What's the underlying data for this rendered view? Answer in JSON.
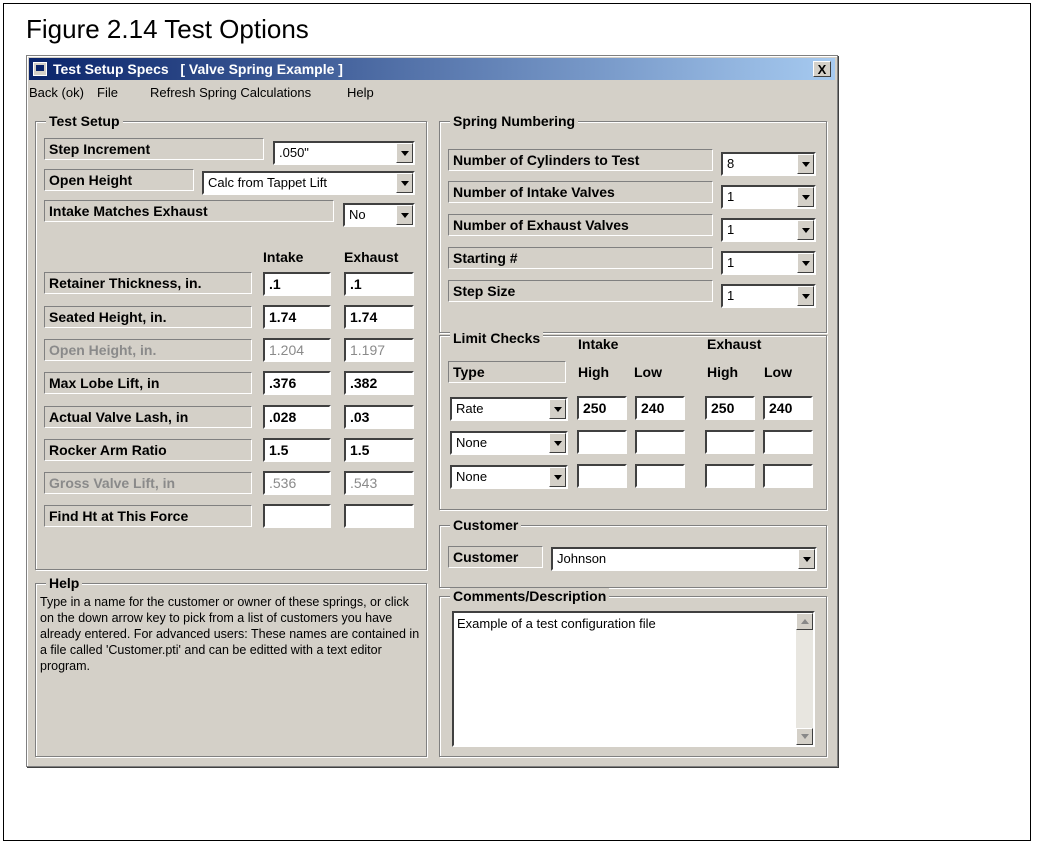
{
  "figure_caption": "Figure 2.14 Test Options",
  "window": {
    "title": "Test Setup Specs   [ Valve Spring Example ]",
    "close_label": "X"
  },
  "menu": [
    "Back (ok)",
    "File",
    "Refresh Spring Calculations",
    "Help"
  ],
  "test_setup": {
    "title": "Test Setup",
    "step_increment": {
      "label": "Step Increment",
      "value": ".050\""
    },
    "open_height": {
      "label": "Open Height",
      "value": "Calc from Tappet Lift"
    },
    "intake_matches_exhaust": {
      "label": "Intake Matches Exhaust",
      "value": "No"
    },
    "col_intake": "Intake",
    "col_exhaust": "Exhaust",
    "rows": [
      {
        "label": "Retainer Thickness, in.",
        "intake": ".1",
        "exhaust": ".1"
      },
      {
        "label": "Seated Height, in.",
        "intake": "1.74",
        "exhaust": "1.74"
      },
      {
        "label": "Open Height, in.",
        "intake": "1.204",
        "exhaust": "1.197"
      },
      {
        "label": "Max Lobe Lift, in",
        "intake": ".376",
        "exhaust": ".382"
      },
      {
        "label": "Actual Valve Lash, in",
        "intake": ".028",
        "exhaust": ".03"
      },
      {
        "label": "Rocker Arm Ratio",
        "intake": "1.5",
        "exhaust": "1.5"
      },
      {
        "label": "Gross Valve Lift, in",
        "intake": ".536",
        "exhaust": ".543"
      },
      {
        "label": "Find Ht at This Force",
        "intake": "",
        "exhaust": ""
      }
    ]
  },
  "help": {
    "title": "Help",
    "text": "Type in a name for the customer or owner of these springs, or click on the down arrow key to pick from a list of customers you have already entered.  For advanced users:  These names are contained in a file called 'Customer.pti' and can be editted with a text editor program."
  },
  "spring_numbering": {
    "title": "Spring Numbering",
    "rows": [
      {
        "label": "Number of Cylinders to Test",
        "value": "8"
      },
      {
        "label": "Number of Intake Valves",
        "value": "1"
      },
      {
        "label": "Number of Exhaust Valves",
        "value": "1"
      },
      {
        "label": "Starting #",
        "value": "1"
      },
      {
        "label": "Step Size",
        "value": "1"
      }
    ]
  },
  "limit_checks": {
    "title": "Limit Checks",
    "hdr_intake": "Intake",
    "hdr_exhaust": "Exhaust",
    "hdr_type": "Type",
    "hdr_high": "High",
    "hdr_low": "Low",
    "rows": [
      {
        "type": "Rate",
        "intake_high": "250",
        "intake_low": "240",
        "exhaust_high": "250",
        "exhaust_low": "240"
      },
      {
        "type": "None",
        "intake_high": "",
        "intake_low": "",
        "exhaust_high": "",
        "exhaust_low": ""
      },
      {
        "type": "None",
        "intake_high": "",
        "intake_low": "",
        "exhaust_high": "",
        "exhaust_low": ""
      }
    ]
  },
  "customer": {
    "title": "Customer",
    "label": "Customer",
    "value": "Johnson"
  },
  "comments": {
    "title": "Comments/Description",
    "value": "Example of a test configuration file"
  }
}
